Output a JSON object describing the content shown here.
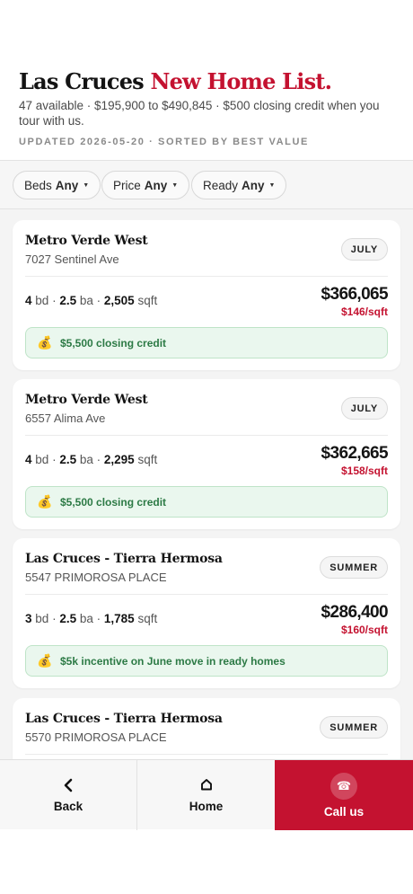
{
  "header": {
    "title_main": "Las Cruces",
    "title_accent": "New Home List.",
    "subtitle": "47 available · $195,900 to $490,845 · $500 closing credit when you tour with us.",
    "meta": "UPDATED 2026-05-20 · SORTED BY BEST VALUE"
  },
  "filters": [
    {
      "label": "Beds",
      "value": "Any"
    },
    {
      "label": "Price",
      "value": "Any"
    },
    {
      "label": "Ready",
      "value": "Any"
    }
  ],
  "listings": [
    {
      "community": "Metro Verde West",
      "address": "7027 Sentinel Ave",
      "ready": "JULY",
      "beds": "4",
      "baths": "2.5",
      "sqft": "2,505",
      "beds_unit": "bd",
      "baths_unit": "ba",
      "sqft_unit": "sqft",
      "price": "$366,065",
      "price_per_sqft": "$146/sqft",
      "incentive": "$5,500 closing credit",
      "incentive_icon": "money-bag-icon"
    },
    {
      "community": "Metro Verde West",
      "address": "6557 Alima Ave",
      "ready": "JULY",
      "beds": "4",
      "baths": "2.5",
      "sqft": "2,295",
      "beds_unit": "bd",
      "baths_unit": "ba",
      "sqft_unit": "sqft",
      "price": "$362,665",
      "price_per_sqft": "$158/sqft",
      "incentive": "$5,500 closing credit",
      "incentive_icon": "money-bag-icon"
    },
    {
      "community": "Las Cruces - Tierra Hermosa",
      "address": "5547 PRIMOROSA PLACE",
      "ready": "SUMMER",
      "beds": "3",
      "baths": "2.5",
      "sqft": "1,785",
      "beds_unit": "bd",
      "baths_unit": "ba",
      "sqft_unit": "sqft",
      "price": "$286,400",
      "price_per_sqft": "$160/sqft",
      "incentive": "$5k incentive on June move in ready homes",
      "incentive_icon": "money-bag-icon"
    },
    {
      "community": "Las Cruces - Tierra Hermosa",
      "address": "5570 PRIMOROSA PLACE",
      "ready": "SUMMER"
    }
  ],
  "bottom_nav": {
    "back_label": "Back",
    "home_label": "Home",
    "call_label": "Call us"
  },
  "colors": {
    "accent": "#c41230",
    "incentive_text": "#2c7a45",
    "incentive_bg": "#eaf7ee"
  }
}
